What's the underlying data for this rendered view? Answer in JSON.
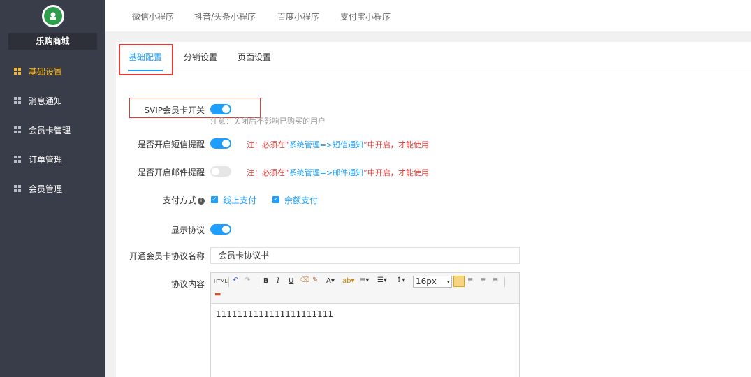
{
  "sidebar": {
    "store_name": "乐购商城",
    "items": [
      {
        "label": "基础设置",
        "active": true
      },
      {
        "label": "消息通知",
        "active": false
      },
      {
        "label": "会员卡管理",
        "active": false
      },
      {
        "label": "订单管理",
        "active": false
      },
      {
        "label": "会员管理",
        "active": false
      }
    ]
  },
  "top_tabs": [
    "微信小程序",
    "抖音/头条小程序",
    "百度小程序",
    "支付宝小程序"
  ],
  "sub_tabs": [
    "基础配置",
    "分销设置",
    "页面设置"
  ],
  "form": {
    "svip_label": "SVIP会员卡开关",
    "svip_on": true,
    "svip_hint": "注意：关闭后不影响已购买的用户",
    "sms_label": "是否开启短信提醒",
    "sms_on": true,
    "sms_warn_pre": "注：必须在“",
    "sms_warn_link": "系统管理=>短信通知",
    "sms_warn_post": "”中开启，才能使用",
    "mail_label": "是否开启邮件提醒",
    "mail_on": false,
    "mail_warn_pre": "注：必须在“",
    "mail_warn_link": "系统管理=>邮件通知",
    "mail_warn_post": "”中开启，才能使用",
    "pay_label": "支付方式",
    "pay_options": [
      "线上支付",
      "余额支付"
    ],
    "agreement_show_label": "显示协议",
    "agreement_show_on": true,
    "agreement_name_label": "开通会员卡协议名称",
    "agreement_name_value": "会员卡协议书",
    "agreement_content_label": "协议内容",
    "editor_font_size": "16px",
    "editor_content": "1111111111111111111111"
  },
  "colors": {
    "sidebar_bg": "#393d49",
    "accent": "#1e9fff",
    "active_nav": "#f7b824",
    "warn": "#e53935"
  }
}
